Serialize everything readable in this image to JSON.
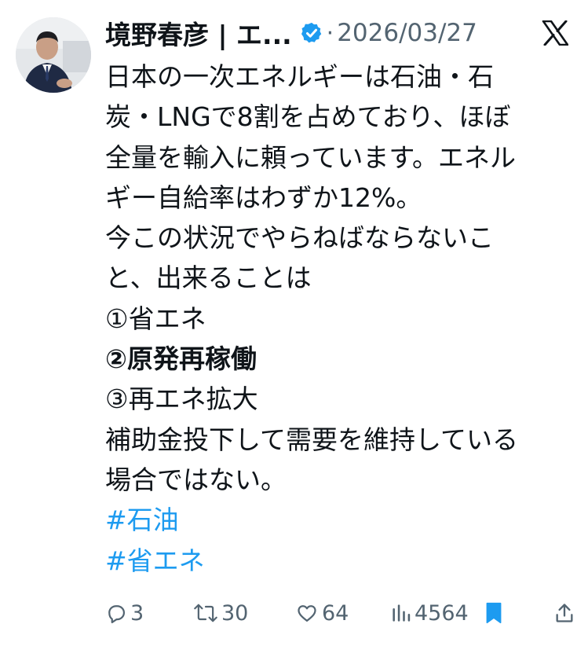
{
  "author": {
    "name": "境野春彦 | エ...",
    "verified_icon": "verified-badge-icon",
    "separator": "·",
    "date": "2026/03/27",
    "platform_icon": "x-logo-icon"
  },
  "post": {
    "lines": [
      "日本の一次エネルギーは石油・石",
      "炭・LNGで8割を占めており、ほぼ",
      "全量を輸入に頼っています。エネル",
      "ギー自給率はわずか12%。",
      "今この状況でやらねばならないこ",
      "と、出来ることは",
      "①省エネ",
      "②原発再稼働",
      "③再エネ拡大",
      "補助金投下して需要を維持している",
      "場合ではない。"
    ],
    "hashtags": [
      "#石油",
      "#省エネ"
    ]
  },
  "actions": {
    "replies": "3",
    "reposts": "30",
    "likes": "64",
    "views": "4564"
  },
  "colors": {
    "text": "#0f1419",
    "secondary": "#536471",
    "link": "#1d9bf0",
    "verified": "#1d9bf0"
  }
}
